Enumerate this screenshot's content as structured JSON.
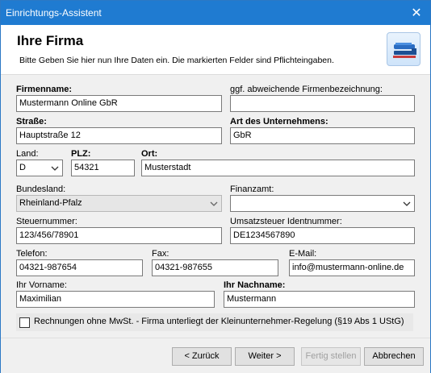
{
  "window": {
    "title": "Einrichtungs-Assistent",
    "close_glyph": "✕"
  },
  "header": {
    "heading": "Ihre Firma",
    "subtitle": "Bitte Geben Sie hier nun Ihre Daten ein. Die markierten Felder sind Pflichteingaben.",
    "logo_icon": "stapler-icon"
  },
  "form": {
    "firmenname": {
      "label": "Firmenname:",
      "value": "Mustermann Online GbR"
    },
    "abw_bezeichnung": {
      "label": "ggf. abweichende Firmenbezeichnung:",
      "value": ""
    },
    "strasse": {
      "label": "Straße:",
      "value": "Hauptstraße 12"
    },
    "art": {
      "label": "Art des Unternehmens:",
      "value": "GbR"
    },
    "land": {
      "label": "Land:",
      "value": "D"
    },
    "plz": {
      "label": "PLZ:",
      "value": "54321"
    },
    "ort": {
      "label": "Ort:",
      "value": "Musterstadt"
    },
    "bundesland": {
      "label": "Bundesland:",
      "value": "Rheinland-Pfalz"
    },
    "finanzamt": {
      "label": "Finanzamt:",
      "value": ""
    },
    "steuernummer": {
      "label": "Steuernummer:",
      "value": "123/456/78901"
    },
    "ust_id": {
      "label": "Umsatzsteuer Identnummer:",
      "value": "DE1234567890"
    },
    "telefon": {
      "label": "Telefon:",
      "value": "04321-987654"
    },
    "fax": {
      "label": "Fax:",
      "value": "04321-987655"
    },
    "email": {
      "label": "E-Mail:",
      "value": "info@mustermann-online.de"
    },
    "vorname": {
      "label": "Ihr Vorname:",
      "value": "Maximilian"
    },
    "nachname": {
      "label": "Ihr Nachname:",
      "value": "Mustermann"
    },
    "kleinunternehmer": {
      "label": "Rechnungen ohne MwSt. - Firma unterliegt der Kleinunternehmer-Regelung (§19 Abs 1 UStG)",
      "checked": false
    }
  },
  "buttons": {
    "back": "< Zurück",
    "next": "Weiter >",
    "finish": "Fertig stellen",
    "cancel": "Abbrechen"
  }
}
